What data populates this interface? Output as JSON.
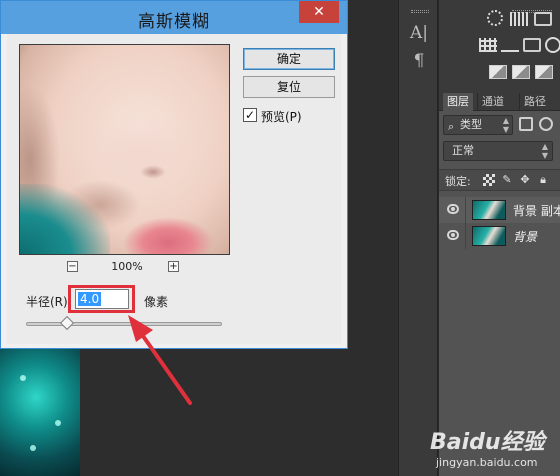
{
  "dialog": {
    "title": "高斯模糊",
    "close_symbol": "✕",
    "ok_label": "确定",
    "reset_label": "复位",
    "preview_label": "预览(P)",
    "preview_checked": true,
    "zoom": {
      "minus": "−",
      "plus": "+",
      "value": "100%"
    },
    "radius": {
      "label": "半径(R)",
      "value": "4.0",
      "unit": "像素"
    }
  },
  "tools": {
    "items": [
      {
        "icon": "text-tool-icon",
        "glyph": "A|"
      },
      {
        "icon": "paragraph-icon",
        "glyph": "¶"
      }
    ]
  },
  "layers_panel": {
    "tabs": [
      "图层",
      "通道",
      "路径"
    ],
    "filter": {
      "label": "类型",
      "icon": "search-icon"
    },
    "blend_mode": "正常",
    "lock_label": "锁定:",
    "layers": [
      {
        "name": "背景 副本",
        "selected": true,
        "italic": false
      },
      {
        "name": "背景",
        "selected": false,
        "italic": true
      }
    ]
  },
  "watermark": {
    "brand": "Baidu经验",
    "url": "jingyan.baidu.com"
  },
  "colors": {
    "title_bar": "#56a0e0",
    "close_button": "#c7423b",
    "highlight_red": "#e0303c",
    "selection_blue": "#3399ff",
    "panel_dark": "#535353"
  }
}
